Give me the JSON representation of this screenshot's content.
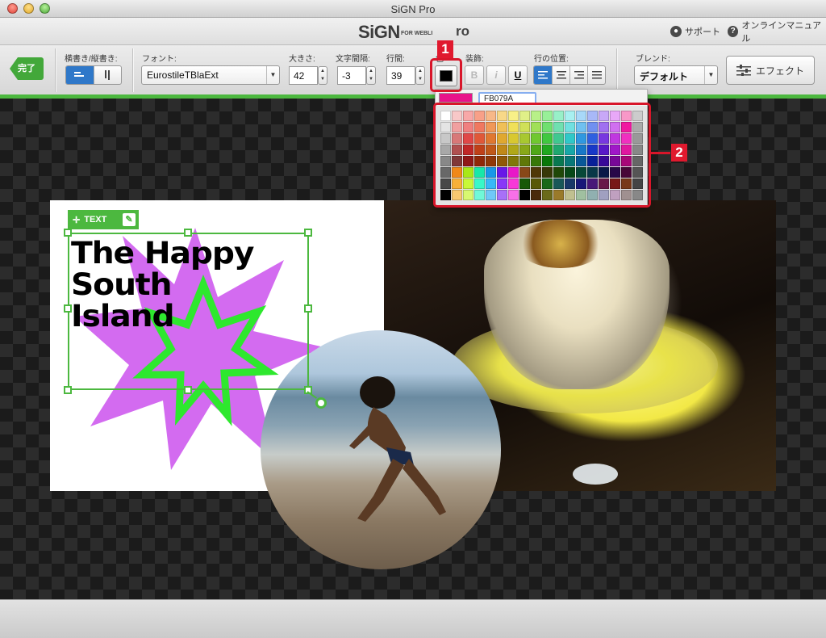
{
  "window": {
    "title": "SiGN Pro"
  },
  "header": {
    "logo_main": "SiGN",
    "logo_sub": "FOR WEBLI",
    "logo_suffix": "ro",
    "support": "サポート",
    "manual": "オンラインマニュアル"
  },
  "toolbar": {
    "done_label": "完了",
    "orientation": {
      "label": "横書き/縦書き:"
    },
    "font": {
      "label": "フォント:",
      "value": "EurostileTBlaExt"
    },
    "size": {
      "label": "大きさ:",
      "value": "42"
    },
    "spacing": {
      "label": "文字間隔:",
      "value": "-3"
    },
    "line_height": {
      "label": "行間:",
      "value": "39"
    },
    "color": {
      "label": "色",
      "value": "#000000"
    },
    "decoration": {
      "label": "装飾:",
      "bold": "B",
      "italic": "i",
      "underline": "U"
    },
    "alignment": {
      "label": "行の位置:"
    },
    "blend": {
      "label": "ブレンド:",
      "value": "デフォルト"
    },
    "effect_label": "エフェクト"
  },
  "color_popup": {
    "current_color": "#E8128A",
    "hex_value": "FB079A",
    "swatches": [
      [
        "#ffffff",
        "#f8c8c8",
        "#f8a8a8",
        "#f8a088",
        "#f8b888",
        "#f8d888",
        "#f8f088",
        "#e0f088",
        "#b8f088",
        "#98f098",
        "#98f0c8",
        "#a8f0f0",
        "#a8d8f8",
        "#a8b8f8",
        "#c8a8f8",
        "#e8a8f8",
        "#f898c8",
        "#cccccc"
      ],
      [
        "#e4e4e4",
        "#f0a0a0",
        "#f08080",
        "#f07860",
        "#f09858",
        "#f0c058",
        "#f0e058",
        "#d0e058",
        "#a0e058",
        "#70e070",
        "#70e0b0",
        "#70e0e0",
        "#70c0f0",
        "#7090f0",
        "#a070f0",
        "#d070f0",
        "#f018a0",
        "#aaaaaa"
      ],
      [
        "#c8c8c8",
        "#d87878",
        "#e04848",
        "#e05838",
        "#e07830",
        "#e0a830",
        "#d8c830",
        "#a8c830",
        "#70c830",
        "#40c840",
        "#40c890",
        "#30c8c8",
        "#3098e0",
        "#3060e0",
        "#7838e0",
        "#c038e0",
        "#f030c0",
        "#999999"
      ],
      [
        "#a8a8a8",
        "#b05050",
        "#c02828",
        "#c04018",
        "#c05818",
        "#c08818",
        "#b0a818",
        "#88a818",
        "#50a818",
        "#20a820",
        "#20a870",
        "#18a8a8",
        "#1878c8",
        "#1838c8",
        "#5818c8",
        "#a018c8",
        "#e018a0",
        "#888888"
      ],
      [
        "#888888",
        "#803838",
        "#901818",
        "#902808",
        "#903808",
        "#905808",
        "#807808",
        "#607808",
        "#387808",
        "#087808",
        "#087850",
        "#087878",
        "#085898",
        "#082098",
        "#380898",
        "#780898",
        "#a80878",
        "#666666"
      ],
      [
        "#686868",
        "#f08818",
        "#a8e818",
        "#18e8a8",
        "#1898e8",
        "#6818e8",
        "#e818c8",
        "#884818",
        "#503808",
        "#383808",
        "#204808",
        "#084818",
        "#084838",
        "#083848",
        "#081848",
        "#280848",
        "#480838",
        "#555555"
      ],
      [
        "#484848",
        "#f8b038",
        "#c8f838",
        "#38f8c8",
        "#38b8f8",
        "#8838f8",
        "#f838d8",
        "#185808",
        "#585808",
        "#186818",
        "#185858",
        "#183868",
        "#181878",
        "#481878",
        "#681848",
        "#781818",
        "#783818",
        "#444444"
      ],
      [
        "#000000",
        "#f8c870",
        "#d8f870",
        "#70f8d8",
        "#70c8f8",
        "#a870f8",
        "#f870e8",
        "#000000",
        "#4a2a0a",
        "#6a6a1a",
        "#9a7a2a",
        "#c0c090",
        "#a0c0a0",
        "#90b0b0",
        "#a0a0c0",
        "#c0a0c0",
        "#a09090",
        "#888888"
      ]
    ]
  },
  "canvas": {
    "text_tag": "TEXT",
    "headline_lines": [
      "The Happy",
      "South",
      "Island"
    ]
  },
  "callouts": {
    "one": "1",
    "two": "2"
  }
}
